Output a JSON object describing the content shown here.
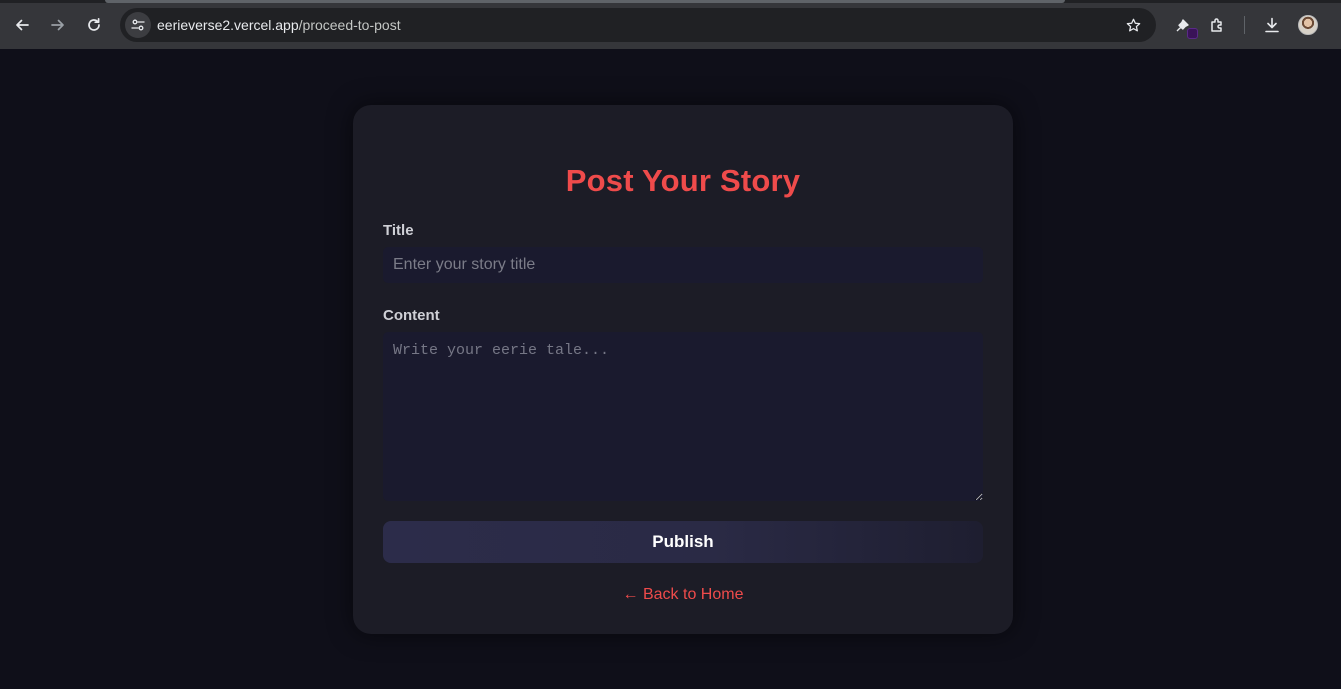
{
  "browser": {
    "url_host": "eerieverse2.vercel.app",
    "url_path": "/proceed-to-post",
    "icons": [
      "back-arrow-icon",
      "forward-arrow-icon",
      "reload-icon",
      "site-info-icon",
      "bookmark-star-icon",
      "extension-pin-icon",
      "extensions-puzzle-icon",
      "download-icon",
      "profile-avatar"
    ]
  },
  "page": {
    "title": "Post Your Story",
    "form": {
      "title_label": "Title",
      "title_placeholder": "Enter your story title",
      "title_value": "",
      "content_label": "Content",
      "content_placeholder": "Write your eerie tale...",
      "content_value": "",
      "publish_label": "Publish"
    },
    "back_link": "← Back to Home"
  },
  "colors": {
    "background": "#0f0f19",
    "card": "#1c1c26",
    "accent": "#ef4b4b",
    "field": "#1a1a2e"
  }
}
